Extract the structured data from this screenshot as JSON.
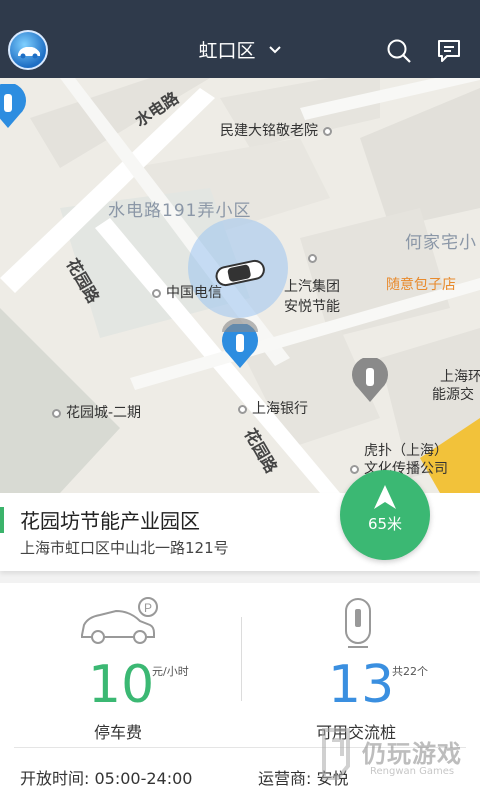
{
  "header": {
    "district": "虹口区",
    "colors": {
      "bar": "#2f3a4b"
    }
  },
  "map": {
    "area_labels": [
      "水电路191弄小区",
      "何家宅小"
    ],
    "road_labels": [
      "水电路",
      "花园路",
      "花园路"
    ],
    "pois": [
      "民建大铭敬老院",
      "上汽集团",
      "安悦节能",
      "中国电信",
      "随意包子店",
      "花园城-二期",
      "上海银行",
      "上海环",
      "能源交",
      "虎扑（上海）",
      "文化传播公司"
    ]
  },
  "station": {
    "name": "花园坊节能产业园区",
    "address": "上海市虹口区中山北一路121号",
    "distance": "65米"
  },
  "stats": {
    "parking": {
      "value": "10",
      "unit": "元/小时",
      "label": "停车费"
    },
    "chargers": {
      "value": "13",
      "unit": "共22个",
      "label": "可用交流桩"
    }
  },
  "footer": {
    "hours": "开放时间: 05:00-24:00",
    "operator": "运营商: 安悦"
  },
  "watermark": {
    "cn": "仍玩游戏",
    "en": "Rengwan Games"
  },
  "colors": {
    "accent_green": "#3bb873",
    "accent_blue": "#3a8fe0",
    "pin_blue": "#2d8de0"
  }
}
